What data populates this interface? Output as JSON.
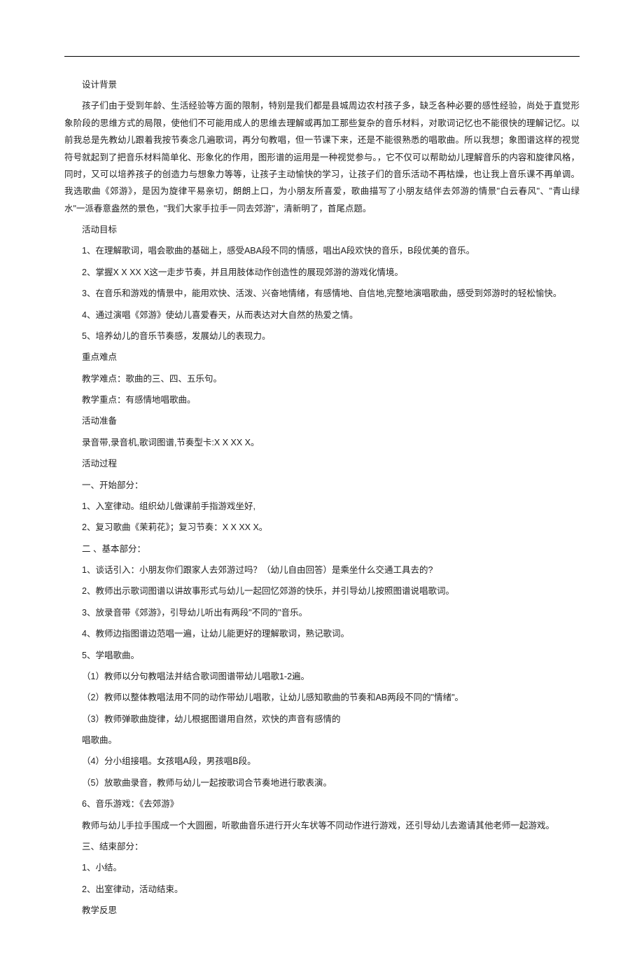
{
  "paragraphs": [
    {
      "kind": "head",
      "text": "设计背景"
    },
    {
      "kind": "body",
      "text": "孩子们由于受到年龄、生活经验等方面的限制，特别是我们都是县城周边农村孩子多，缺乏各种必要的感性经验，尚处于直觉形象阶段的思维方式的局限，使他们不可能用成人的思维去理解或再加工那些复杂的音乐材料，对歌词记忆也不能很快的理解记忆。以前我总是先教幼儿跟着我按节奏念几遍歌词，再分句教唱，但一节课下来，还是不能很熟悉的唱歌曲。所以我想；象图谱这样的视觉符号就起到了把音乐材料简单化、形象化的作用，图形谱的运用是一种视觉参与。，它不仅可以帮助幼儿理解音乐的内容和旋律风格，同时，又可以培养孩子的创造力与想象力等等，让孩子主动愉快的学习，让孩子们的音乐活动不再枯燥，也让我上音乐课不再单调。我选歌曲《郊游》，是因为旋律平易亲切，朗朗上口，为小朋友所喜爱，歌曲描写了小朋友结伴去郊游的情景\"白云春风\"、\"青山绿水\"一派春意盎然的景色，\"我们大家手拉手一同去郊游\"，清新明了，首尾点题。"
    },
    {
      "kind": "head",
      "text": "活动目标"
    },
    {
      "kind": "body",
      "text": "1、在理解歌词，唱会歌曲的基础上，感受ABA段不同的情感，唱出A段欢快的音乐，B段优美的音乐。"
    },
    {
      "kind": "body",
      "text": "2、掌握X X XX X这一走步节奏，并且用肢体动作创造性的展现郊游的游戏化情境。"
    },
    {
      "kind": "body",
      "text": "3、在音乐和游戏的情景中，能用欢快、活泼、兴奋地情绪，有感情地、自信地,完整地演唱歌曲，感受到郊游时的轻松愉快。"
    },
    {
      "kind": "body",
      "text": "4、通过演唱《郊游》使幼儿喜爱春天，从而表达对大自然的热爱之情。"
    },
    {
      "kind": "body",
      "text": "5、培养幼儿的音乐节奏感，发展幼儿的表现力。"
    },
    {
      "kind": "head",
      "text": "重点难点"
    },
    {
      "kind": "body",
      "text": "教学难点：歌曲的三、四、五乐句。"
    },
    {
      "kind": "body",
      "text": "教学重点：有感情地唱歌曲。"
    },
    {
      "kind": "head",
      "text": "活动准备"
    },
    {
      "kind": "body",
      "text": "录音带,录音机,歌词图谱,节奏型卡:X X XX X。"
    },
    {
      "kind": "head",
      "text": "活动过程"
    },
    {
      "kind": "body",
      "text": "一、开始部分："
    },
    {
      "kind": "body",
      "text": "1、入室律动。组织幼儿做课前手指游戏坐好,"
    },
    {
      "kind": "body",
      "text": "2、复习歌曲《茉莉花》；复习节奏：X X XX X。"
    },
    {
      "kind": "body",
      "text": "二 、基本部分："
    },
    {
      "kind": "body",
      "text": "1、谈话引入：小朋友你们跟家人去郊游过吗？（幼儿自由回答）是乘坐什么交通工具去的?"
    },
    {
      "kind": "body",
      "text": "2、教师出示歌词图谱以讲故事形式与幼儿一起回忆郊游的快乐，并引导幼儿按照图谱说唱歌词。"
    },
    {
      "kind": "body",
      "text": "3、放录音带《郊游》，引导幼儿听出有两段\"不同的\"音乐。"
    },
    {
      "kind": "body",
      "text": "4、教师边指图谱边范唱一遍，让幼儿能更好的理解歌词，熟记歌词。"
    },
    {
      "kind": "body",
      "text": "5、学唱歌曲。"
    },
    {
      "kind": "body",
      "text": "（1）教师以分句教唱法并结合歌词图谱带幼儿唱歌1-2遍。"
    },
    {
      "kind": "body",
      "text": "（2）教师以整体教唱法用不同的动作带幼儿唱歌，让幼儿感知歌曲的节奏和AB两段不同的\"情绪\"。"
    },
    {
      "kind": "body",
      "text": "（3）教师弹歌曲旋律，幼儿根据图谱用自然，欢快的声音有感情的"
    },
    {
      "kind": "body",
      "text": "唱歌曲。"
    },
    {
      "kind": "body",
      "text": "（4）分小组接唱。女孩唱A段，男孩唱B段。"
    },
    {
      "kind": "body",
      "text": "（5）放歌曲录音，教师与幼儿一起按歌词合节奏地进行歌表演。"
    },
    {
      "kind": "body",
      "text": "6、音乐游戏：《去郊游》"
    },
    {
      "kind": "body",
      "text": "教师与幼儿手拉手围成一个大圆圈，听歌曲音乐进行开火车状等不同动作进行游戏，还引导幼儿去邀请其他老师一起游戏。"
    },
    {
      "kind": "body",
      "text": "三、结束部分："
    },
    {
      "kind": "body",
      "text": "1、小结。"
    },
    {
      "kind": "body",
      "text": "2、出室律动，活动结束。"
    },
    {
      "kind": "head",
      "text": "教学反思"
    }
  ]
}
